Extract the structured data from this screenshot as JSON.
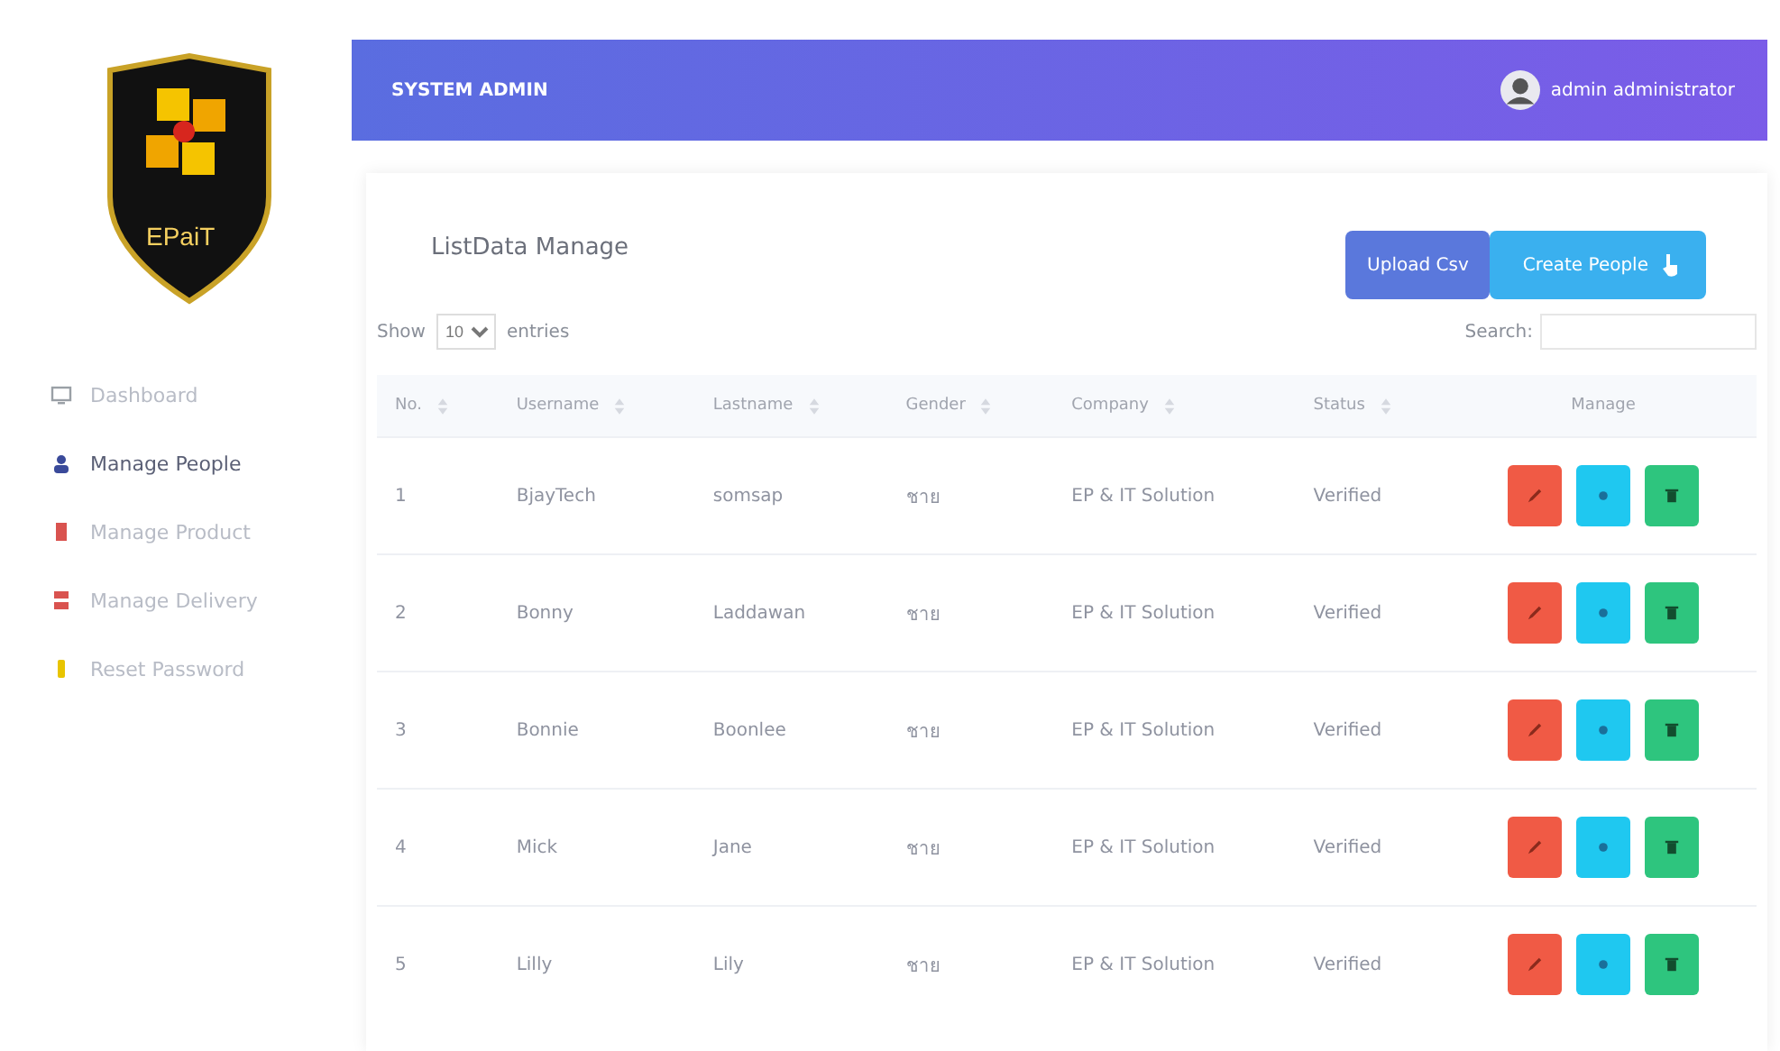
{
  "logo": {
    "text": "EPaiT"
  },
  "sidebar": {
    "items": [
      {
        "label": "Dashboard",
        "kind": "monitor",
        "color": "#9aa0a6",
        "selected": false
      },
      {
        "label": "Manage People",
        "kind": "person",
        "color": "#3a4a9a",
        "selected": true
      },
      {
        "label": "Manage Product",
        "kind": "box",
        "color": "#d9534f",
        "selected": false
      },
      {
        "label": "Manage Delivery",
        "kind": "truck",
        "color": "#d9534f",
        "selected": false
      },
      {
        "label": "Reset Password",
        "kind": "key",
        "color": "#e8c400",
        "selected": false
      }
    ]
  },
  "header": {
    "title": "SYSTEM ADMIN",
    "user": "admin administrator"
  },
  "card": {
    "title": "ListData Manage",
    "buttons": [
      {
        "label": "Upload Csv",
        "kind": "upload"
      },
      {
        "label": "Create People",
        "kind": "create"
      }
    ],
    "length": {
      "before": "Show",
      "value": "10",
      "after": "entries"
    },
    "search": {
      "label": "Search:"
    }
  },
  "table": {
    "columns": [
      "No.",
      "Username",
      "Lastname",
      "Gender",
      "Company",
      "Status",
      "Manage"
    ],
    "rows": [
      {
        "cells": [
          "1",
          "BjayTech",
          "somsap",
          "ชาย",
          "EP & IT Solution",
          "Verified"
        ]
      },
      {
        "cells": [
          "2",
          "Bonny",
          "Laddawan",
          "ชาย",
          "EP & IT Solution",
          "Verified"
        ]
      },
      {
        "cells": [
          "3",
          "Bonnie",
          "Boonlee",
          "ชาย",
          "EP & IT Solution",
          "Verified"
        ]
      },
      {
        "cells": [
          "4",
          "Mick",
          "Jane",
          "ชาย",
          "EP & IT Solution",
          "Verified"
        ]
      },
      {
        "cells": [
          "5",
          "Lilly",
          "Lily",
          "ชาย",
          "EP & IT Solution",
          "Verified"
        ]
      }
    ],
    "actions": [
      {
        "kind": "edit"
      },
      {
        "kind": "view"
      },
      {
        "kind": "delete"
      }
    ]
  }
}
